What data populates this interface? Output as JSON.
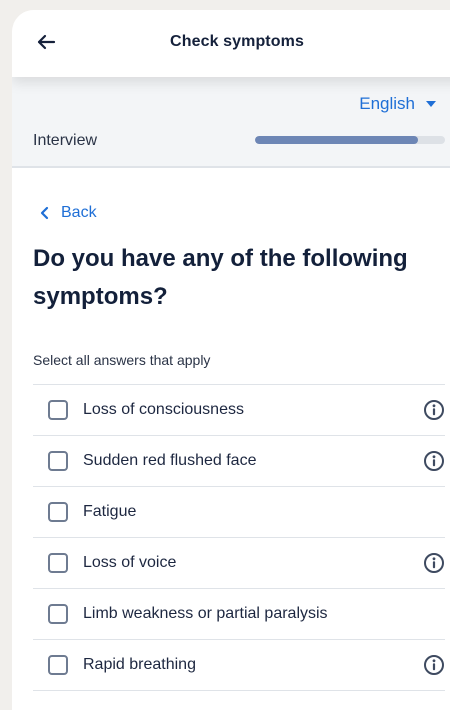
{
  "header": {
    "title": "Check symptoms",
    "back_icon": "arrow-left-icon"
  },
  "language": {
    "selected": "English",
    "icon": "caret-down-icon"
  },
  "progress": {
    "label": "Interview",
    "value": 0.86,
    "color": "#6d86b5"
  },
  "nav": {
    "back_label": "Back"
  },
  "question": {
    "title": "Do you have any of the following symptoms?",
    "instruction": "Select all answers that apply"
  },
  "options": [
    {
      "label": "Loss of consciousness",
      "checked": false,
      "has_info": true
    },
    {
      "label": "Sudden red flushed face",
      "checked": false,
      "has_info": true
    },
    {
      "label": "Fatigue",
      "checked": false,
      "has_info": false
    },
    {
      "label": "Loss of voice",
      "checked": false,
      "has_info": true
    },
    {
      "label": "Limb weakness or partial paralysis",
      "checked": false,
      "has_info": false
    },
    {
      "label": "Rapid breathing",
      "checked": false,
      "has_info": true
    }
  ],
  "colors": {
    "accent": "#1f6fd6",
    "text": "#13203a"
  }
}
